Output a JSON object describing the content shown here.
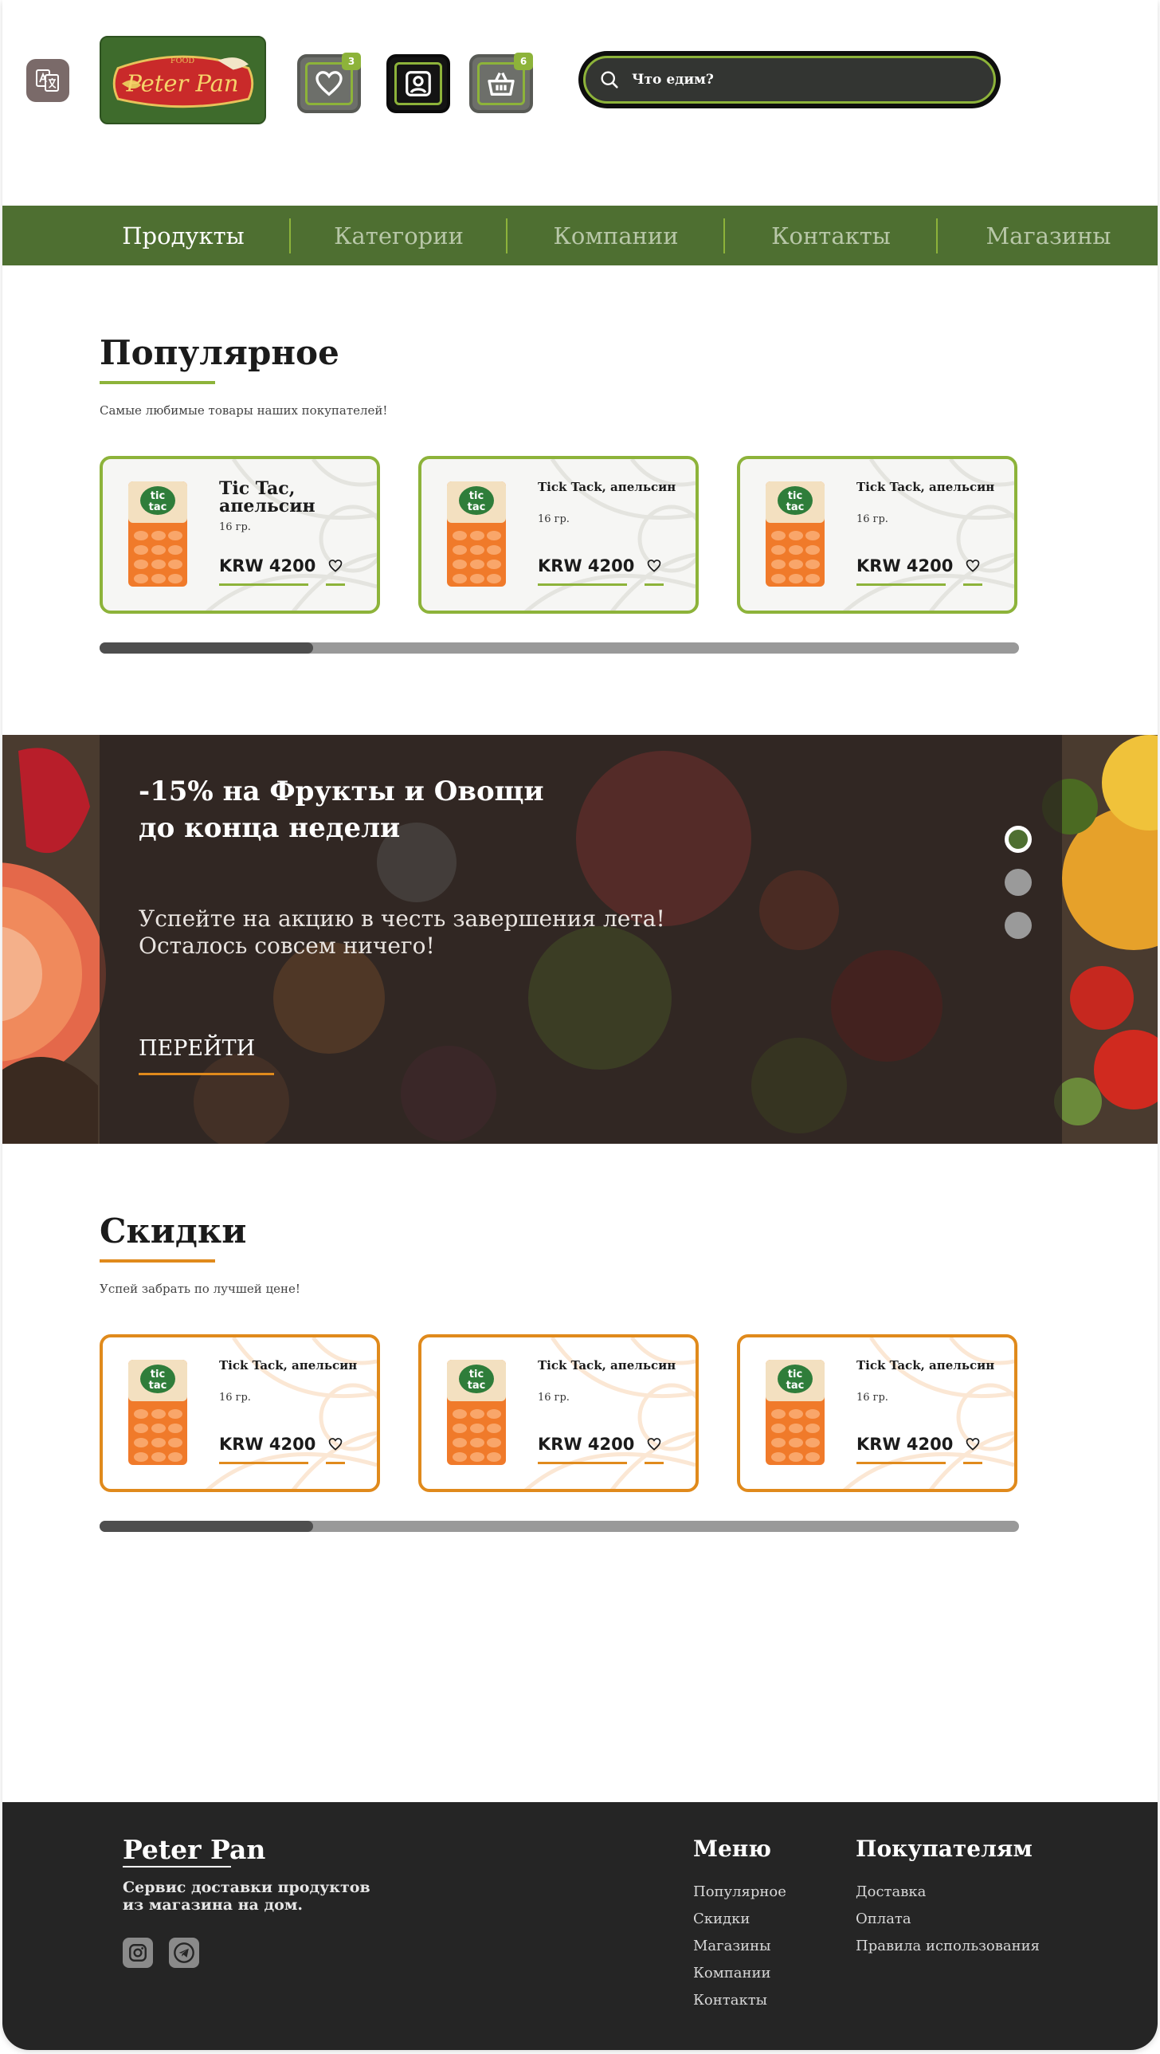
{
  "header": {
    "logo_text": "Peter Pan",
    "logo_small": "FOOD",
    "favorites_count": "3",
    "cart_count": "6",
    "search_placeholder": "Что едим?"
  },
  "nav": {
    "items": [
      {
        "label": "Продукты",
        "active": true
      },
      {
        "label": "Категории",
        "active": false
      },
      {
        "label": "Компании",
        "active": false
      },
      {
        "label": "Контакты",
        "active": false
      },
      {
        "label": "Магазины",
        "active": false
      }
    ]
  },
  "popular": {
    "title": "Популярное",
    "subtitle": "Самые любимые товары наших покупателей!",
    "accent": "#8db33a",
    "products": [
      {
        "name": "Tic Tac, апельсин",
        "weight": "16 гр.",
        "price": "KRW 4200"
      },
      {
        "name": "Tick Tack, апельсин",
        "weight": "16 гр.",
        "price": "KRW 4200"
      },
      {
        "name": "Tick Tack, апельсин",
        "weight": "16 гр.",
        "price": "KRW 4200"
      }
    ]
  },
  "banner": {
    "title_line1": "-15% на Фрукты и Овощи",
    "title_line2": "до конца недели",
    "text_line1": "Успейте на акцию в честь завершения лета!",
    "text_line2": "Осталось совсем ничего!",
    "link": "ПЕРЕЙТИ",
    "slides": 3,
    "active_slide": 1
  },
  "discounts": {
    "title": "Скидки",
    "subtitle": "Успей забрать по лучшей цене!",
    "accent": "#e08a1c",
    "products": [
      {
        "name": "Tick Tack, апельсин",
        "weight": "16 гр.",
        "price": "KRW 4200"
      },
      {
        "name": "Tick Tack, апельсин",
        "weight": "16 гр.",
        "price": "KRW 4200"
      },
      {
        "name": "Tick Tack, апельсин",
        "weight": "16 гр.",
        "price": "KRW 4200"
      }
    ]
  },
  "footer": {
    "brand": "Peter Pan",
    "description_line1": "Сервис доставки продуктов",
    "description_line2": "из магазина на дом.",
    "menu_title": "Меню",
    "menu": [
      "Популярное",
      "Скидки",
      "Магазины",
      "Компании",
      "Контакты"
    ],
    "customers_title": "Покупателям",
    "customers": [
      "Доставка",
      "Оплата",
      "Правила использования"
    ]
  },
  "colors": {
    "nav_bg": "#4e6f31",
    "green_accent": "#8db33a",
    "orange_accent": "#e08a1c",
    "footer_bg": "#252525"
  }
}
